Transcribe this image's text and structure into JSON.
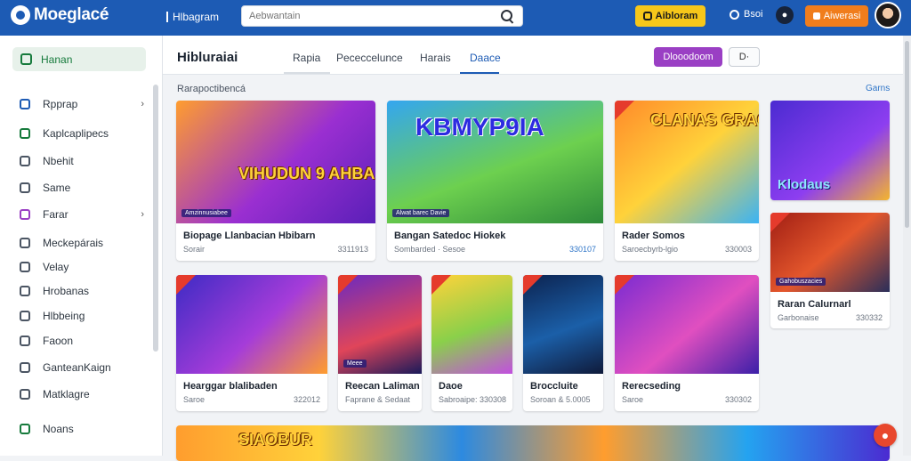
{
  "topbar": {
    "logo_text": "Moeglacé",
    "nav_link": "Hlbagram",
    "search_placeholder": "Aebwantain",
    "yellow_button": "Aibloram",
    "user_link": "Bsoi",
    "orange_button": "Aiwerasi",
    "colors": {
      "bar": "#1d5bb4",
      "yellow": "#f6c71a",
      "orange": "#f07d1c"
    }
  },
  "sidebar": {
    "top_item": "Hanan",
    "items": [
      {
        "label": "Rpprap",
        "icon": "shield-icon",
        "chevron": "›"
      },
      {
        "label": "Kaplcaplipecs",
        "icon": "grid-icon",
        "chevron": ""
      },
      {
        "label": "Nbehit",
        "icon": "doc-icon",
        "chevron": ""
      },
      {
        "label": "Same",
        "icon": "gamepad-icon",
        "chevron": ""
      },
      {
        "label": "Farar",
        "icon": "star-icon",
        "chevron": "›"
      },
      {
        "label": "Meckepárais",
        "icon": "list-icon",
        "chevron": ""
      },
      {
        "label": "Velay",
        "icon": "clock-icon",
        "chevron": ""
      },
      {
        "label": "Hrobanas",
        "icon": "folder-icon",
        "chevron": ""
      },
      {
        "label": "Hlbbeing",
        "icon": "chart-icon",
        "chevron": ""
      },
      {
        "label": "Faoon",
        "icon": "tag-icon",
        "chevron": ""
      },
      {
        "label": "GanteanKaign",
        "icon": "user-icon",
        "chevron": ""
      },
      {
        "label": "Matklagre",
        "icon": "settings-icon",
        "chevron": ""
      },
      {
        "label": "Noans",
        "icon": "bell-icon",
        "chevron": ""
      }
    ]
  },
  "main": {
    "title": "Hibluraiai",
    "tabs": [
      "Rapia",
      "Pececcelunce",
      "Harais",
      "Daace"
    ],
    "active_tab": 3,
    "purple_button": "Dlooodoom",
    "small_button": "D·",
    "section_label": "Rarapoctibencá",
    "see_all": "Garns"
  },
  "cards": [
    {
      "title": "Biopage Llanbacian Hbibarn",
      "sub": "Sorair",
      "meta": "3311913",
      "meta_blue": false,
      "badge": "Amzinnusiabee",
      "thumb_text": "VIHUDUN 9 AHBA"
    },
    {
      "title": "Bangan Satedoc Hiokek",
      "sub": "Sombarded · Sesoe",
      "meta": "330107",
      "meta_blue": true,
      "badge": "Alwat barec Davie",
      "thumb_text": "KBMYP9IA"
    },
    {
      "title": "Rader Somos",
      "sub": "Saroecbyrb-lgio",
      "meta": "330003",
      "meta_blue": false,
      "badge": "",
      "thumb_text": "CLANAS GRAGS"
    },
    {
      "title": "",
      "sub": "",
      "meta": "",
      "meta_blue": false,
      "badge": "",
      "thumb_text": "Klodaus"
    },
    {
      "title": "Raran Calurnarl",
      "sub": "Garbonaise",
      "meta": "330332",
      "meta_blue": false,
      "badge": "Gahobuszacies",
      "thumb_text": ""
    },
    {
      "title": "Hearggar blalibaden",
      "sub": "Saroe",
      "meta": "322012",
      "meta_blue": false,
      "badge": "",
      "thumb_text": ""
    },
    {
      "title": "Reecan Laliman",
      "sub": "Faprane & Sedaat",
      "meta": "",
      "meta_blue": false,
      "badge": "Meee",
      "thumb_text": ""
    },
    {
      "title": "Daoe",
      "sub": "Sabroaipe: 330308",
      "meta": "",
      "meta_blue": false,
      "badge": "",
      "thumb_text": ""
    },
    {
      "title": "Broccluite",
      "sub": "Soroan & 5.0005",
      "meta": "",
      "meta_blue": false,
      "badge": "",
      "thumb_text": ""
    },
    {
      "title": "Rerecseding",
      "sub": "Saroe",
      "meta": "330302",
      "meta_blue": false,
      "badge": "",
      "thumb_text": ""
    },
    {
      "title": "",
      "sub": "",
      "meta": "",
      "meta_blue": false,
      "badge": "",
      "thumb_text": "SIAOBUR"
    }
  ]
}
